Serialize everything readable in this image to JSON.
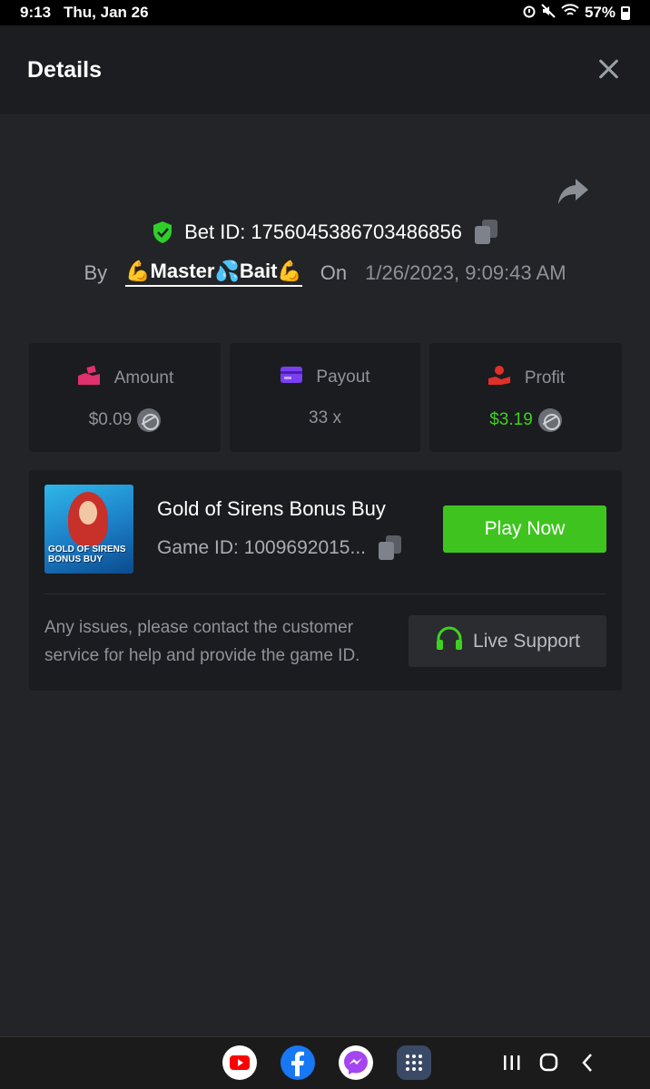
{
  "status_bar": {
    "time": "9:13",
    "date": "Thu, Jan 26",
    "battery": "57%"
  },
  "header": {
    "title": "Details"
  },
  "bet": {
    "id_label": "Bet ID: 1756045386703486856",
    "by_label": "By",
    "username": "💪Master💦Bait💪",
    "on_label": "On",
    "datetime": "1/26/2023, 9:09:43 AM"
  },
  "stats": [
    {
      "label": "Amount",
      "value": "$0.09",
      "icon": "money-hand-icon"
    },
    {
      "label": "Payout",
      "value": "33 x",
      "icon": "card-icon"
    },
    {
      "label": "Profit",
      "value": "$3.19",
      "icon": "profit-hand-icon"
    }
  ],
  "game": {
    "title": "Gold of Sirens Bonus Buy",
    "id_label": "Game ID: 1009692015...",
    "thumb_text_1": "GOLD OF SIRENS",
    "thumb_text_2": "BONUS BUY",
    "play_label": "Play Now"
  },
  "support": {
    "text": "Any issues, please contact the customer service for help and provide the game ID.",
    "button_label": "Live Support"
  },
  "colors": {
    "accent_green": "#3fc41f",
    "profit_green": "#3fd11f",
    "shield_green": "#2fcf2a"
  },
  "nav_apps": [
    "youtube-icon",
    "facebook-icon",
    "messenger-icon",
    "app-drawer-icon"
  ]
}
